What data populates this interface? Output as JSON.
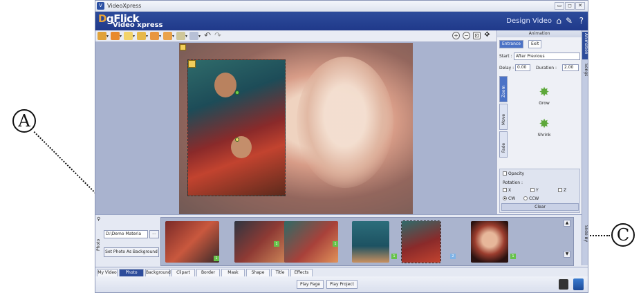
{
  "window": {
    "title": "VideoXpress",
    "buttons": [
      "▭",
      "◻",
      "✕"
    ]
  },
  "header": {
    "brand": "gFlick",
    "brand_initial": "D",
    "product": "Video xpress",
    "mode_label": "Design Video",
    "icons": [
      "home-icon",
      "wrench-icon",
      "help-icon"
    ],
    "help_glyph": "?"
  },
  "toolbar": {
    "right_icons": [
      "zoom-in-icon",
      "zoom-out-icon",
      "fit-icon",
      "move-icon"
    ]
  },
  "animation_panel": {
    "title": "Animation",
    "tabs": [
      {
        "label": "Entrance",
        "active": true
      },
      {
        "label": "Exit",
        "active": false
      }
    ],
    "start_label": "Start :",
    "start_value": "After Previous",
    "delay_label": "Delay :",
    "delay_value": "0.00",
    "duration_label": "Duration :",
    "duration_value": "2.00",
    "categories": [
      "Zoom",
      "Move",
      "Fade"
    ],
    "effects": [
      "Grow",
      "Shrink"
    ],
    "opacity_label": "Opacity",
    "rotation_label": "Rotation :",
    "axes": [
      "X",
      "Y",
      "Z"
    ],
    "direction": [
      {
        "label": "CW",
        "selected": true
      },
      {
        "label": "CCW",
        "selected": false
      }
    ],
    "clear_label": "Clear"
  },
  "side_tabs": [
    "Animation",
    "Songs",
    "Slide By"
  ],
  "photo_panel": {
    "side_label": "Photo",
    "path_value": "D:\\Demo Materia",
    "browse_label": "...",
    "set_bg_label": "Set Photo As Background",
    "thumbnails": [
      {
        "badge": "1",
        "badge_color": "#66c24a"
      },
      {
        "badge": "1",
        "badge_color": "#66c24a"
      },
      {
        "badge": "1",
        "badge_color": "#66c24a"
      },
      {
        "badge": "1",
        "badge_color": "#66c24a"
      },
      {
        "badge": "2",
        "badge_color": "#7fb3e6"
      },
      {
        "badge": "1",
        "badge_color": "#66c24a"
      }
    ]
  },
  "bottom_tabs": [
    {
      "label": "My Video",
      "active": false
    },
    {
      "label": "Photo",
      "active": true
    },
    {
      "label": "Background",
      "active": false
    },
    {
      "label": "Clipart",
      "active": false
    },
    {
      "label": "Border",
      "active": false
    },
    {
      "label": "Mask",
      "active": false
    },
    {
      "label": "Shape",
      "active": false
    },
    {
      "label": "Title",
      "active": false
    },
    {
      "label": "Effects",
      "active": false
    }
  ],
  "footer": {
    "play_page": "Play Page",
    "play_project": "Play Project"
  },
  "callouts": {
    "a": "A",
    "c": "C"
  },
  "colors": {
    "header_blue": "#2d4c9b",
    "accent_green": "#66c24a",
    "canvas_bg": "#a9b3cf"
  }
}
